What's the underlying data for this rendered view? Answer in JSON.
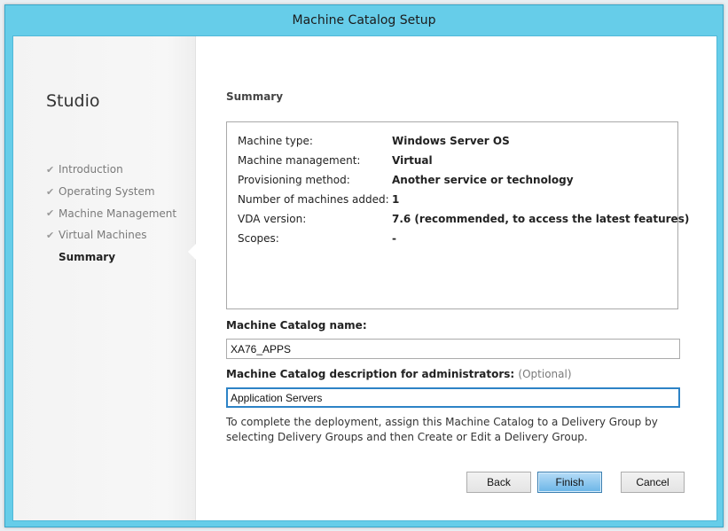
{
  "window": {
    "title": "Machine Catalog Setup"
  },
  "sidebar": {
    "title": "Studio",
    "steps": [
      {
        "label": "Introduction",
        "done": true
      },
      {
        "label": "Operating System",
        "done": true
      },
      {
        "label": "Machine Management",
        "done": true
      },
      {
        "label": "Virtual Machines",
        "done": true
      },
      {
        "label": "Summary",
        "done": false,
        "current": true
      }
    ]
  },
  "summary": {
    "heading": "Summary",
    "rows": [
      {
        "label": "Machine type:",
        "value": "Windows Server OS"
      },
      {
        "label": "Machine management:",
        "value": "Virtual"
      },
      {
        "label": "Provisioning method:",
        "value": "Another service or technology"
      },
      {
        "label": "Number of machines added:",
        "value": "1"
      },
      {
        "label": "VDA version:",
        "value": "7.6 (recommended, to access the latest features)"
      },
      {
        "label": "Scopes:",
        "value": "-"
      }
    ]
  },
  "catalog_name": {
    "label": "Machine Catalog name:",
    "value": "XA76_APPS"
  },
  "catalog_description": {
    "label": "Machine Catalog description for administrators:",
    "optional": "(Optional)",
    "value": "Application Servers"
  },
  "info": "To complete the deployment, assign this Machine Catalog to a Delivery Group by selecting Delivery Groups and then Create or Edit a Delivery Group.",
  "buttons": {
    "back": "Back",
    "finish": "Finish",
    "cancel": "Cancel"
  },
  "icons": {
    "step_done": "checkmark-icon"
  }
}
